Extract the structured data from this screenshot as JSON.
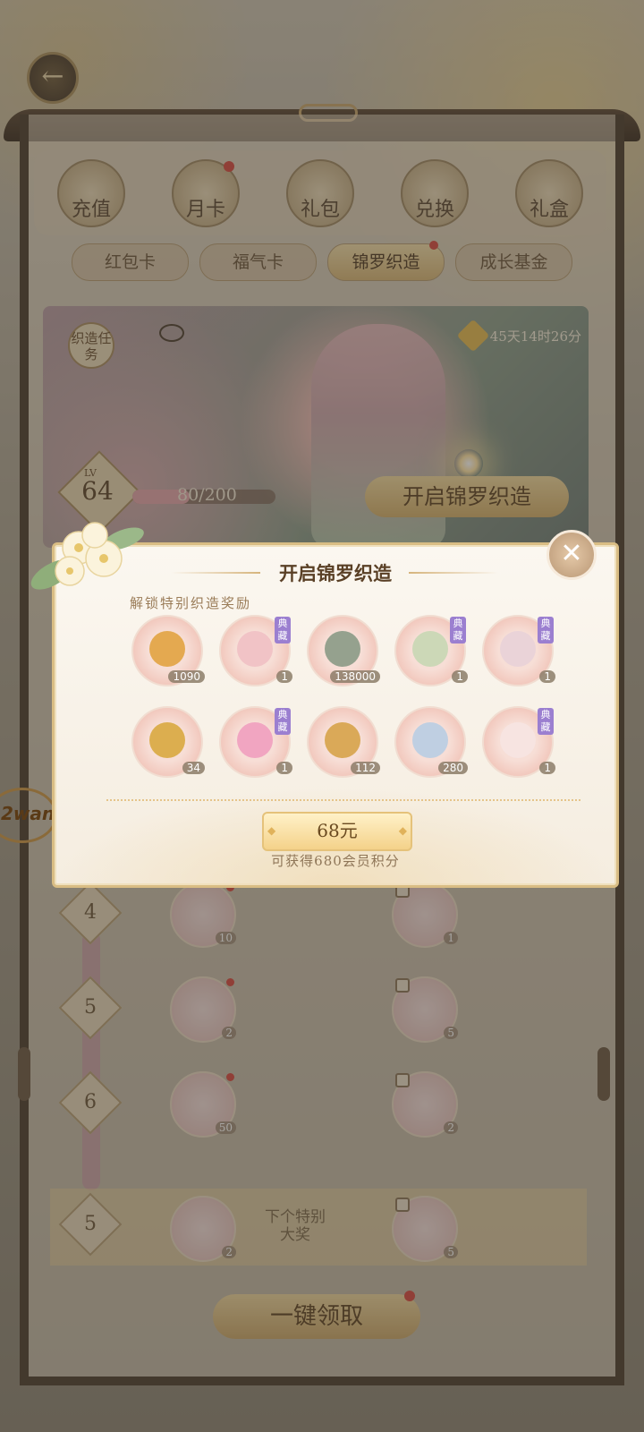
{
  "top_nav": [
    {
      "label": "充值",
      "dot": false
    },
    {
      "label": "月卡",
      "dot": true
    },
    {
      "label": "礼包",
      "dot": false
    },
    {
      "label": "兑换",
      "dot": false
    },
    {
      "label": "礼盒",
      "dot": false
    }
  ],
  "sub_tabs": [
    {
      "label": "红包卡",
      "active": false,
      "dot": false
    },
    {
      "label": "福气卡",
      "active": false,
      "dot": false
    },
    {
      "label": "锦罗织造",
      "active": true,
      "dot": true
    },
    {
      "label": "成长基金",
      "active": false,
      "dot": false
    }
  ],
  "banner": {
    "task_label": "织造任务",
    "timer": "45天14时26分",
    "level_tag": "LV",
    "level": "64",
    "progress_text": "80/200",
    "progress_fraction": 0.4,
    "open_button": "开启锦罗织造"
  },
  "popup": {
    "title": "开启锦罗织造",
    "subtitle": "解锁特别织造奖励",
    "collect_tag": "典藏",
    "items": [
      {
        "icon": "gold-coin-icon",
        "count": "1090",
        "collect": false
      },
      {
        "icon": "hair-ornament-icon",
        "count": "1",
        "collect": true
      },
      {
        "icon": "copper-coin-icon",
        "count": "138000",
        "collect": false
      },
      {
        "icon": "flower-accessory-icon",
        "count": "1",
        "collect": true
      },
      {
        "icon": "shoe-icon",
        "count": "1",
        "collect": true
      },
      {
        "icon": "incense-bundle-icon",
        "count": "34",
        "collect": false
      },
      {
        "icon": "pink-hairstyle-icon",
        "count": "1",
        "collect": true
      },
      {
        "icon": "gold-chest-icon",
        "count": "112",
        "collect": false
      },
      {
        "icon": "silver-chest-icon",
        "count": "280",
        "collect": false
      },
      {
        "icon": "white-garment-icon",
        "count": "1",
        "collect": true
      }
    ],
    "price": "68元",
    "gain_text": "可获得680会员积分",
    "close_icon": "close-icon"
  },
  "list_rows": [
    {
      "num": "4",
      "free_count": "10",
      "paid_count": "1"
    },
    {
      "num": "5",
      "free_count": "2",
      "paid_count": "5"
    },
    {
      "num": "6",
      "free_count": "50",
      "paid_count": "2"
    }
  ],
  "next_row": {
    "num": "5",
    "free_count": "2",
    "label": "下个特别大奖",
    "paid_count": "5"
  },
  "claim_button": "一键领取",
  "watermark": "2wan"
}
